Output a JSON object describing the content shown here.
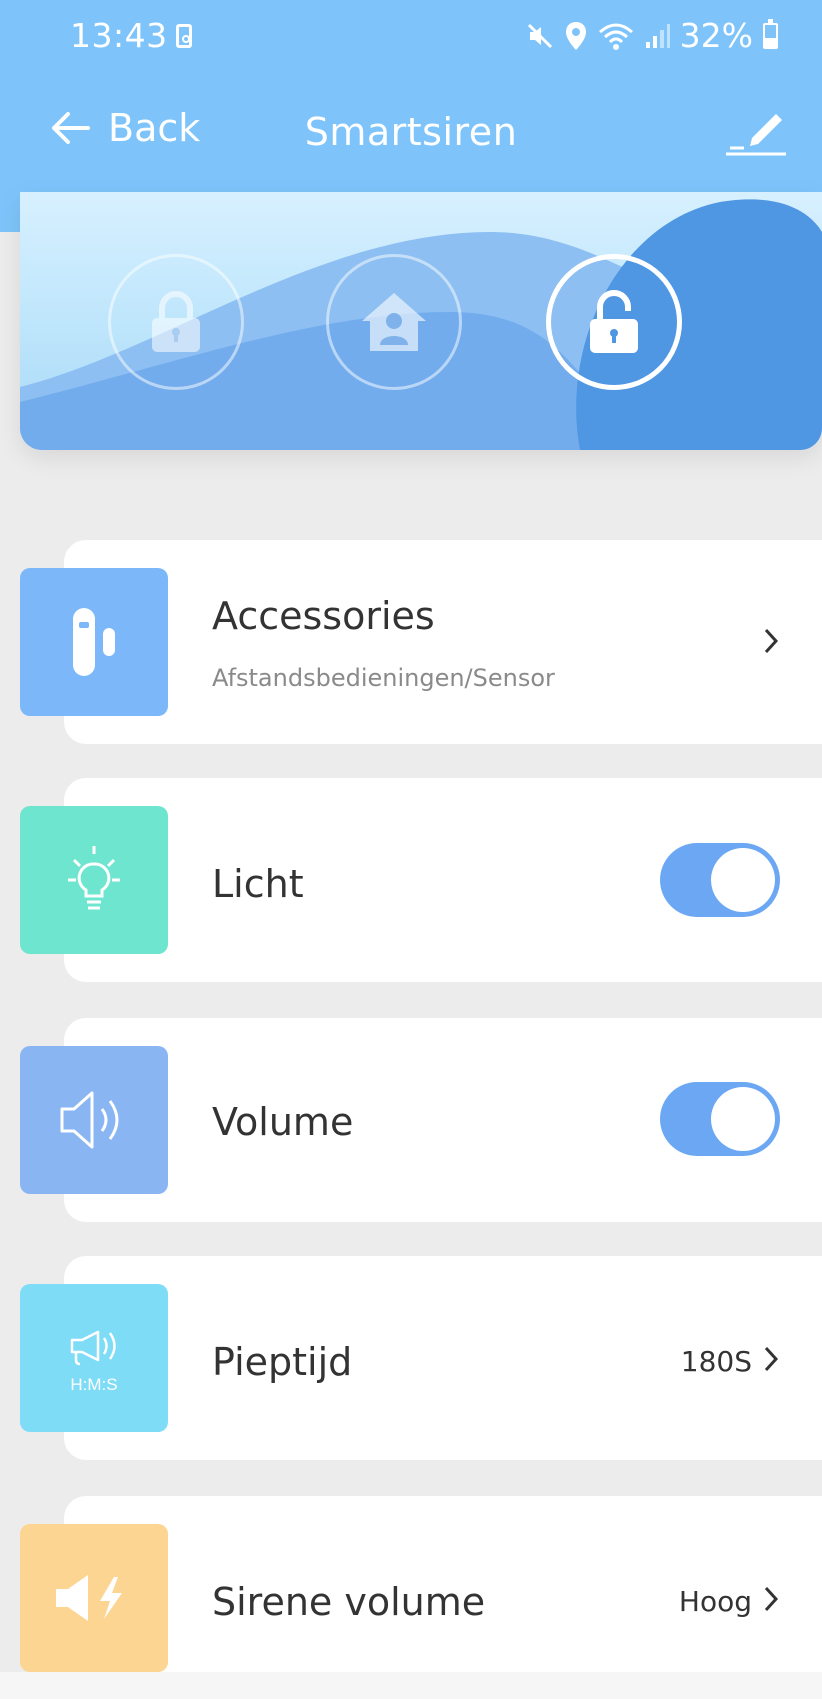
{
  "status_bar": {
    "time": "13:43",
    "battery": "32%"
  },
  "header": {
    "back_label": "Back",
    "title": "Smartsiren"
  },
  "modes": [
    {
      "name": "arm-mode",
      "icon": "lock-icon",
      "active": false
    },
    {
      "name": "home-mode",
      "icon": "home-person-icon",
      "active": false
    },
    {
      "name": "disarm-mode",
      "icon": "unlock-icon",
      "active": true
    }
  ],
  "items": {
    "accessories": {
      "title": "Accessories",
      "subtitle": "Afstandsbedieningen/Sensor",
      "icon": "sensor-icon"
    },
    "licht": {
      "title": "Licht",
      "toggle": true,
      "icon": "lightbulb-icon"
    },
    "volume": {
      "title": "Volume",
      "toggle": true,
      "icon": "speaker-icon"
    },
    "pieptijd": {
      "title": "Pieptijd",
      "value": "180S",
      "icon": "megaphone-icon",
      "icon_text": "H:M:S"
    },
    "sirene": {
      "title": "Sirene volume",
      "value": "Hoog",
      "icon": "siren-volume-icon"
    }
  },
  "colors": {
    "header": "#7ec4fa",
    "accessories_icon": "#7cb8f9",
    "licht_icon": "#6ee6cf",
    "volume_icon": "#8ab5f3",
    "pieptijd_icon": "#7fdcf7",
    "sirene_icon": "#fdd593",
    "toggle_on": "#6ca7f4"
  }
}
